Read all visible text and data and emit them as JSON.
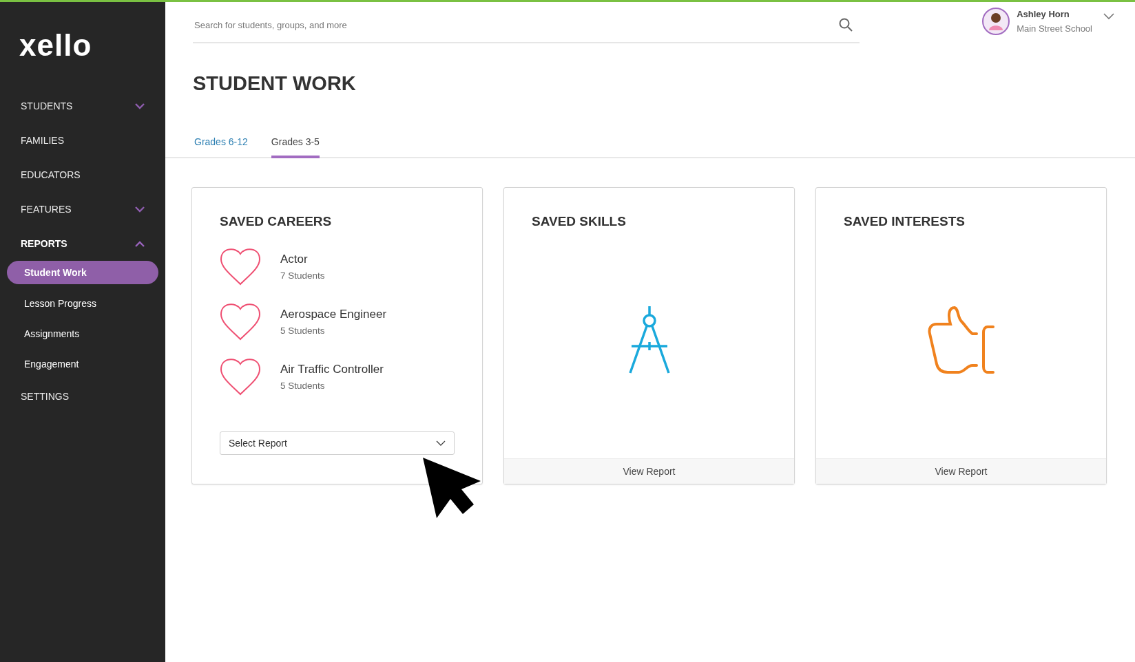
{
  "sidebar": {
    "logo": "xello",
    "items": [
      {
        "label": "STUDENTS",
        "selected": false,
        "expanded": false
      },
      {
        "label": "FAMILIES",
        "selected": false
      },
      {
        "label": "EDUCATORS",
        "selected": false
      },
      {
        "label": "FEATURES",
        "selected": false,
        "expanded": false
      },
      {
        "label": "REPORTS",
        "selected": true,
        "expanded": true,
        "children": [
          {
            "label": "Student Work",
            "selected": true
          },
          {
            "label": "Lesson Progress",
            "selected": false
          },
          {
            "label": "Assignments",
            "selected": false
          },
          {
            "label": "Engagement",
            "selected": false
          }
        ]
      },
      {
        "label": "SETTINGS",
        "selected": false
      }
    ]
  },
  "search": {
    "placeholder": "Search for students, groups, and more"
  },
  "user": {
    "name": "Ashley Horn",
    "school": "Main Street School"
  },
  "page": {
    "title": "STUDENT WORK"
  },
  "tabs": [
    {
      "label": "Grades 6-12",
      "selected": false
    },
    {
      "label": "Grades 3-5",
      "selected": true
    }
  ],
  "cards": [
    {
      "kind": "careers",
      "title": "SAVED CAREERS",
      "careers": [
        {
          "name": "Actor",
          "count": "7 Students"
        },
        {
          "name": "Aerospace Engineer",
          "count": "5 Students"
        },
        {
          "name": "Air Traffic Controller",
          "count": "5 Students"
        }
      ],
      "select": {
        "placeholder": "Select Report"
      }
    },
    {
      "kind": "skills",
      "title": "SAVED SKILLS",
      "button": "View Report"
    },
    {
      "kind": "interests",
      "title": "SAVED INTERESTS",
      "button": "View Report"
    }
  ]
}
